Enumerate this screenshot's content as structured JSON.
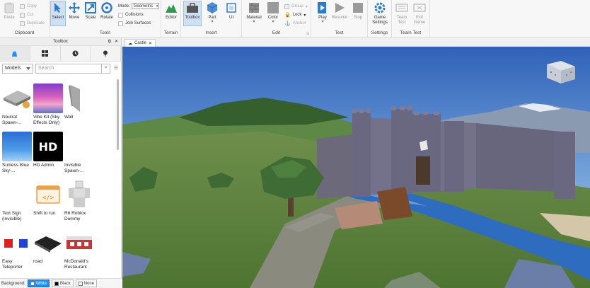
{
  "ribbon": {
    "clipboard": {
      "paste": "Paste",
      "copy": "Copy",
      "cut": "Cut",
      "duplicate": "Duplicate",
      "label": "Clipboard"
    },
    "tools": {
      "select": "Select",
      "move": "Move",
      "scale": "Scale",
      "rotate": "Rotate",
      "mode_label": "Mode:",
      "mode_value": "Geometric",
      "collisions": "Collisions",
      "join": "Join Surfaces",
      "label": "Tools"
    },
    "terrain": {
      "editor": "Editor",
      "label": "Terrain"
    },
    "insert": {
      "toolbox": "Toolbox",
      "part": "Part",
      "ui": "UI",
      "label": "Insert"
    },
    "edit": {
      "material": "Material",
      "color": "Color",
      "group": "Group",
      "lock": "Lock",
      "anchor": "Anchor",
      "label": "Edit"
    },
    "test": {
      "play": "Play",
      "resume": "Resume",
      "stop": "Stop",
      "label": "Test"
    },
    "settings": {
      "game_settings": "Game Settings",
      "label": "Settings"
    },
    "team_test": {
      "team_test": "Team Test",
      "exit_game": "Exit Game",
      "label": "Team Test"
    }
  },
  "toolbox": {
    "title": "Toolbox",
    "category": "Models",
    "search_placeholder": "Search",
    "items": [
      {
        "label": "Neutral Spawn-..."
      },
      {
        "label": "Vibe Kit (Sky Effects Only)"
      },
      {
        "label": "Wall"
      },
      {
        "label": "Sunless Blue Sky-..."
      },
      {
        "label": "HD Admin",
        "thumb_text": "HD"
      },
      {
        "label": "Invisible Spawn-..."
      },
      {
        "label": "Text Sign (invisible)"
      },
      {
        "label": "Shift to run"
      },
      {
        "label": "R6 Roblox Dummy"
      },
      {
        "label": "Easy Teleporter"
      },
      {
        "label": "road"
      },
      {
        "label": "McDonald's Restaurant"
      }
    ],
    "background": {
      "label": "Background:",
      "white": "White",
      "black": "Black",
      "none": "None"
    }
  },
  "viewport": {
    "tab_label": "Castle"
  },
  "colors": {
    "accent": "#1a90ff",
    "sky_top": "#2f62b8",
    "grass": "#5a7d3a"
  }
}
